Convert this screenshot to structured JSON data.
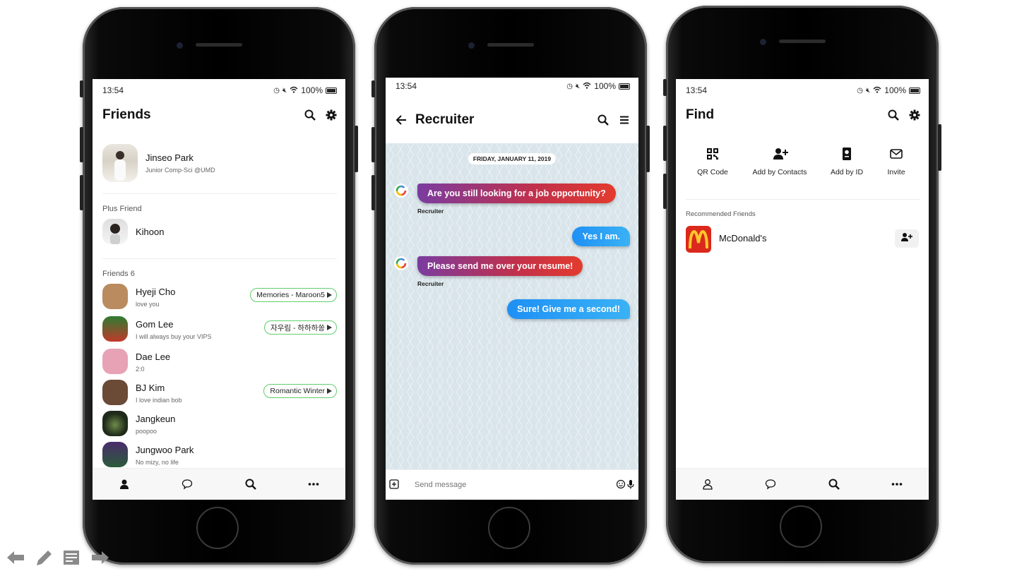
{
  "friends": {
    "status_time": "13:54",
    "battery": "100%",
    "title": "Friends",
    "profile": {
      "name": "Jinseo Park",
      "subtitle": "Junior Comp-Sci @UMD"
    },
    "plus_friend_label": "Plus Friend",
    "plus_friend": {
      "name": "Kihoon"
    },
    "friends_label": "Friends 6",
    "list": [
      {
        "name": "Hyeji Cho",
        "status": "love you",
        "music": "Memories - Maroon5",
        "color": "#b98b5e"
      },
      {
        "name": "Gom Lee",
        "status": "I will always buy your VIPS",
        "music": "자우림 - 하하하쏭",
        "color": "#c0392b"
      },
      {
        "name": "Dae Lee",
        "status": "2:0",
        "music": "",
        "color": "#e7a2b6"
      },
      {
        "name": "BJ Kim",
        "status": "I love indian bob",
        "music": "Romantic Winter",
        "color": "#6b4a36"
      },
      {
        "name": "Jangkeun",
        "status": "poopoo",
        "music": "",
        "color": "#1f2a1a"
      },
      {
        "name": "Jungwoo Park",
        "status": "No mizy, no life",
        "music": "",
        "color": "#4a2c6b"
      }
    ]
  },
  "chat": {
    "status_time": "13:54",
    "battery": "100%",
    "title": "Recruiter",
    "date": "FRIDAY, JANUARY 11, 2019",
    "messages": [
      {
        "text": "Are you still looking for a job opportunity?",
        "from": "recv",
        "sender": "Recruiter"
      },
      {
        "text": "Yes I am.",
        "from": "sent"
      },
      {
        "text": "Please send me over your resume!",
        "from": "recv",
        "sender": "Recruiter"
      },
      {
        "text": "Sure! Give me a second!",
        "from": "sent"
      }
    ],
    "input_placeholder": "Send message"
  },
  "find": {
    "status_time": "13:54",
    "battery": "100%",
    "title": "Find",
    "options": [
      {
        "label": "QR Code",
        "icon": "qr-code-icon"
      },
      {
        "label": "Add by Contacts",
        "icon": "add-person-icon"
      },
      {
        "label": "Add by ID",
        "icon": "id-book-icon"
      },
      {
        "label": "Invite",
        "icon": "envelope-icon"
      }
    ],
    "recommended_label": "Recommended Friends",
    "recommended": [
      {
        "name": "McDonald's",
        "color": "#da291c"
      }
    ]
  },
  "colors": {
    "accent_green": "#5fce6f",
    "bubble_blue": "#1e90f5",
    "bubble_red": "#e33b2e"
  }
}
